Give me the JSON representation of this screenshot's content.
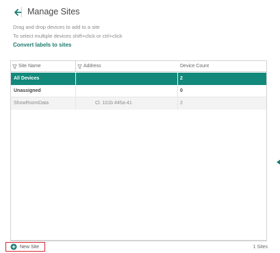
{
  "header": {
    "title": "Manage Sites"
  },
  "instructions": {
    "line1": "Drag and drop devices to add to a site",
    "line2": "To select multiple devices shift+click or ctrl+click"
  },
  "convert_link": "Convert labels to sites",
  "table": {
    "columns": [
      "Site Name",
      "Address",
      "Device Count"
    ],
    "rows": [
      {
        "name": "All Devices",
        "address": "",
        "count": "2",
        "selected": true
      },
      {
        "name": "Unassigned",
        "address": "",
        "count": "0",
        "selected": false
      },
      {
        "name": "ShowRoomData",
        "address": "Cl. 101b #45a-41",
        "count": "2",
        "selected": false
      }
    ]
  },
  "footer": {
    "new_site_label": "New Site",
    "site_count": "1 Sites"
  },
  "colors": {
    "accent": "#12897a",
    "highlight_border": "#d9232e"
  },
  "icons": {
    "back": "arrow-left-icon",
    "filter": "filter-icon",
    "add": "plus-circle-icon",
    "side": "chevron-left-icon"
  }
}
